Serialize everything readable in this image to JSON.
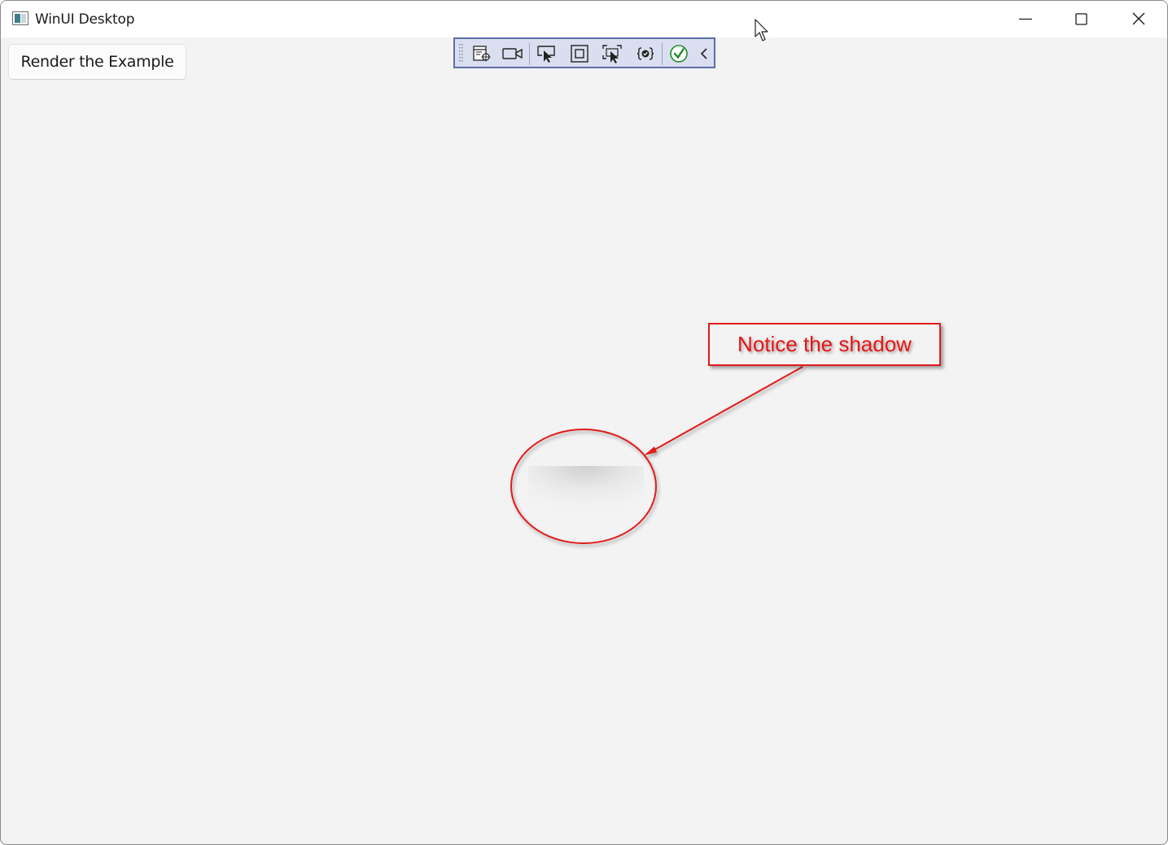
{
  "window": {
    "title": "WinUI Desktop",
    "controls": {
      "minimize": "minimize-icon",
      "maximize": "maximize-icon",
      "close": "close-icon"
    }
  },
  "main": {
    "render_button_label": "Render the Example"
  },
  "debug_toolbar": {
    "tools": [
      "go-to-live-visual-tree-icon",
      "record-icon",
      "select-element-icon",
      "display-layout-adorners-icon",
      "track-focused-element-icon",
      "binding-failures-icon",
      "hot-reload-check-icon",
      "collapse-chevron-icon"
    ]
  },
  "annotation": {
    "text": "Notice the shadow",
    "color": "#e81414"
  }
}
